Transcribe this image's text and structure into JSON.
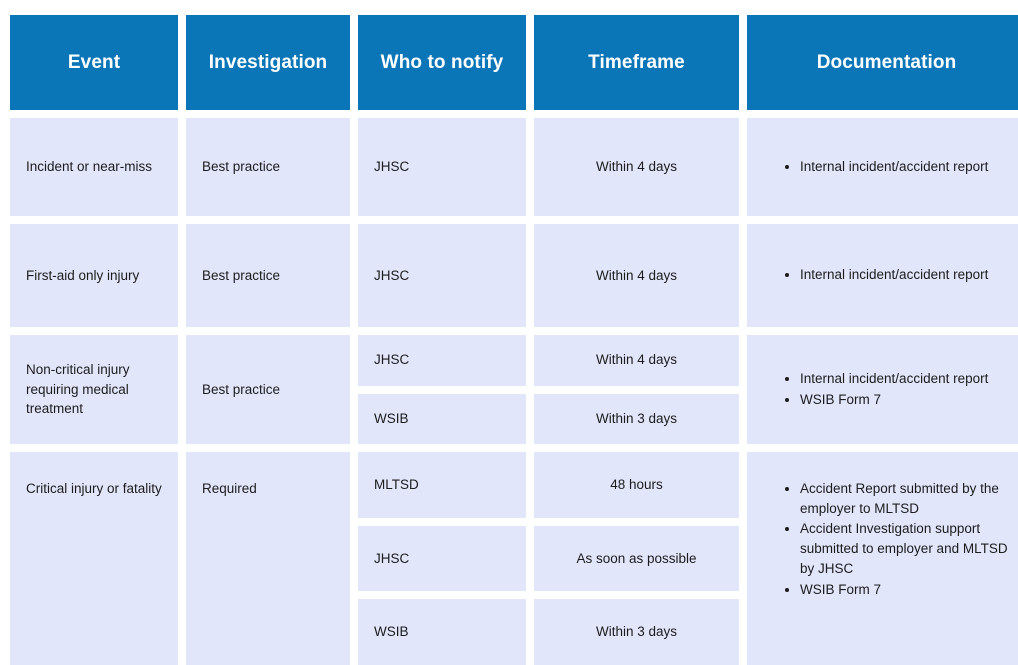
{
  "table": {
    "columns": [
      {
        "key": "event",
        "label": "Event"
      },
      {
        "key": "investigation",
        "label": "Investigation"
      },
      {
        "key": "notify",
        "label": "Who to notify"
      },
      {
        "key": "timeframe",
        "label": "Timeframe"
      },
      {
        "key": "documentation",
        "label": "Documentation"
      }
    ],
    "colors": {
      "header_bg": "#0a76b8",
      "header_text": "#ffffff",
      "cell_bg": "#e2e6fa",
      "cell_text": "#1c1c1c",
      "page_bg": "#ffffff"
    },
    "rows": [
      {
        "event": "Incident or near-miss",
        "investigation": "Best practice",
        "notify": [
          "JHSC"
        ],
        "timeframe": [
          "Within 4 days"
        ],
        "documentation": [
          "Internal incident/accident report"
        ]
      },
      {
        "event": "First-aid only injury",
        "investigation": "Best practice",
        "notify": [
          "JHSC"
        ],
        "timeframe": [
          "Within 4 days"
        ],
        "documentation": [
          "Internal incident/accident report"
        ]
      },
      {
        "event": "Non-critical injury requiring medical treatment",
        "investigation": "Best practice",
        "notify": [
          "JHSC",
          "WSIB"
        ],
        "timeframe": [
          "Within 4 days",
          "Within 3 days"
        ],
        "documentation": [
          "Internal incident/accident report",
          "WSIB Form 7"
        ]
      },
      {
        "event": "Critical injury or fatality",
        "investigation": "Required",
        "notify": [
          "MLTSD",
          "JHSC",
          "WSIB"
        ],
        "timeframe": [
          "48 hours",
          "As soon as possible",
          "Within 3 days"
        ],
        "documentation": [
          "Accident Report submitted by the employer to MLTSD",
          "Accident Investigation support submitted to employer and MLTSD by JHSC",
          "WSIB Form 7"
        ]
      }
    ]
  }
}
